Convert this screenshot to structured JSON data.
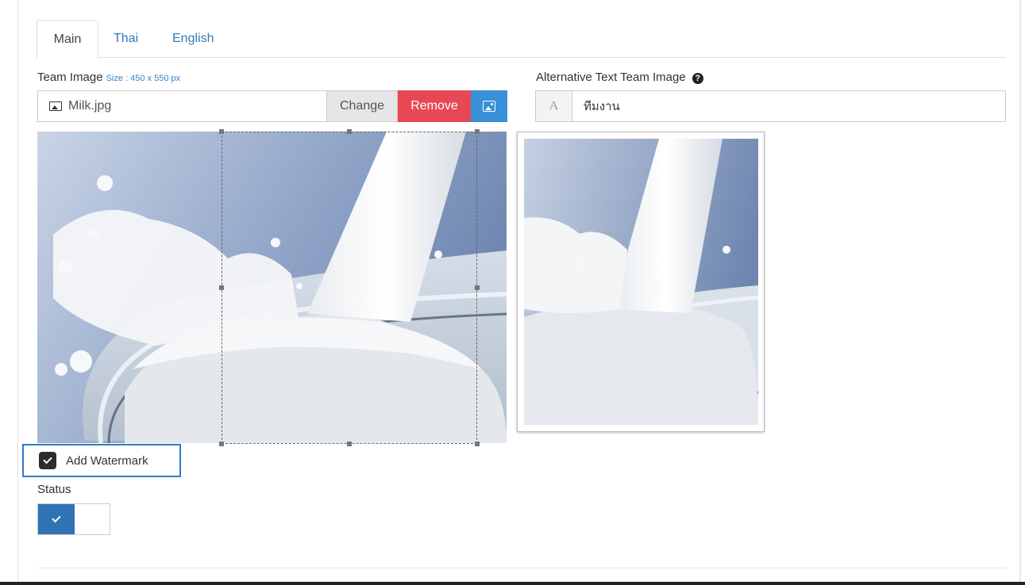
{
  "tabs": {
    "main": "Main",
    "thai": "Thai",
    "english": "English"
  },
  "team_image": {
    "label": "Team Image",
    "size_note": "Size : 450 x 550 px",
    "file_name": "Milk.jpg",
    "change_label": "Change",
    "remove_label": "Remove",
    "icon": "image-icon",
    "crop_icon": "picture-icon"
  },
  "alt_text": {
    "label": "Alternative Text Team Image",
    "addon": "A",
    "value": "ทีมงาน",
    "help_icon": "question-circle-icon"
  },
  "watermark": {
    "label": "Add Watermark",
    "checked": true
  },
  "status": {
    "label": "Status",
    "enabled": true
  },
  "colors": {
    "link": "#337ab7",
    "remove": "#e84855",
    "crop": "#3a8fd9",
    "toggle_on": "#2f73b5",
    "focus_border": "#2f7bc4"
  }
}
